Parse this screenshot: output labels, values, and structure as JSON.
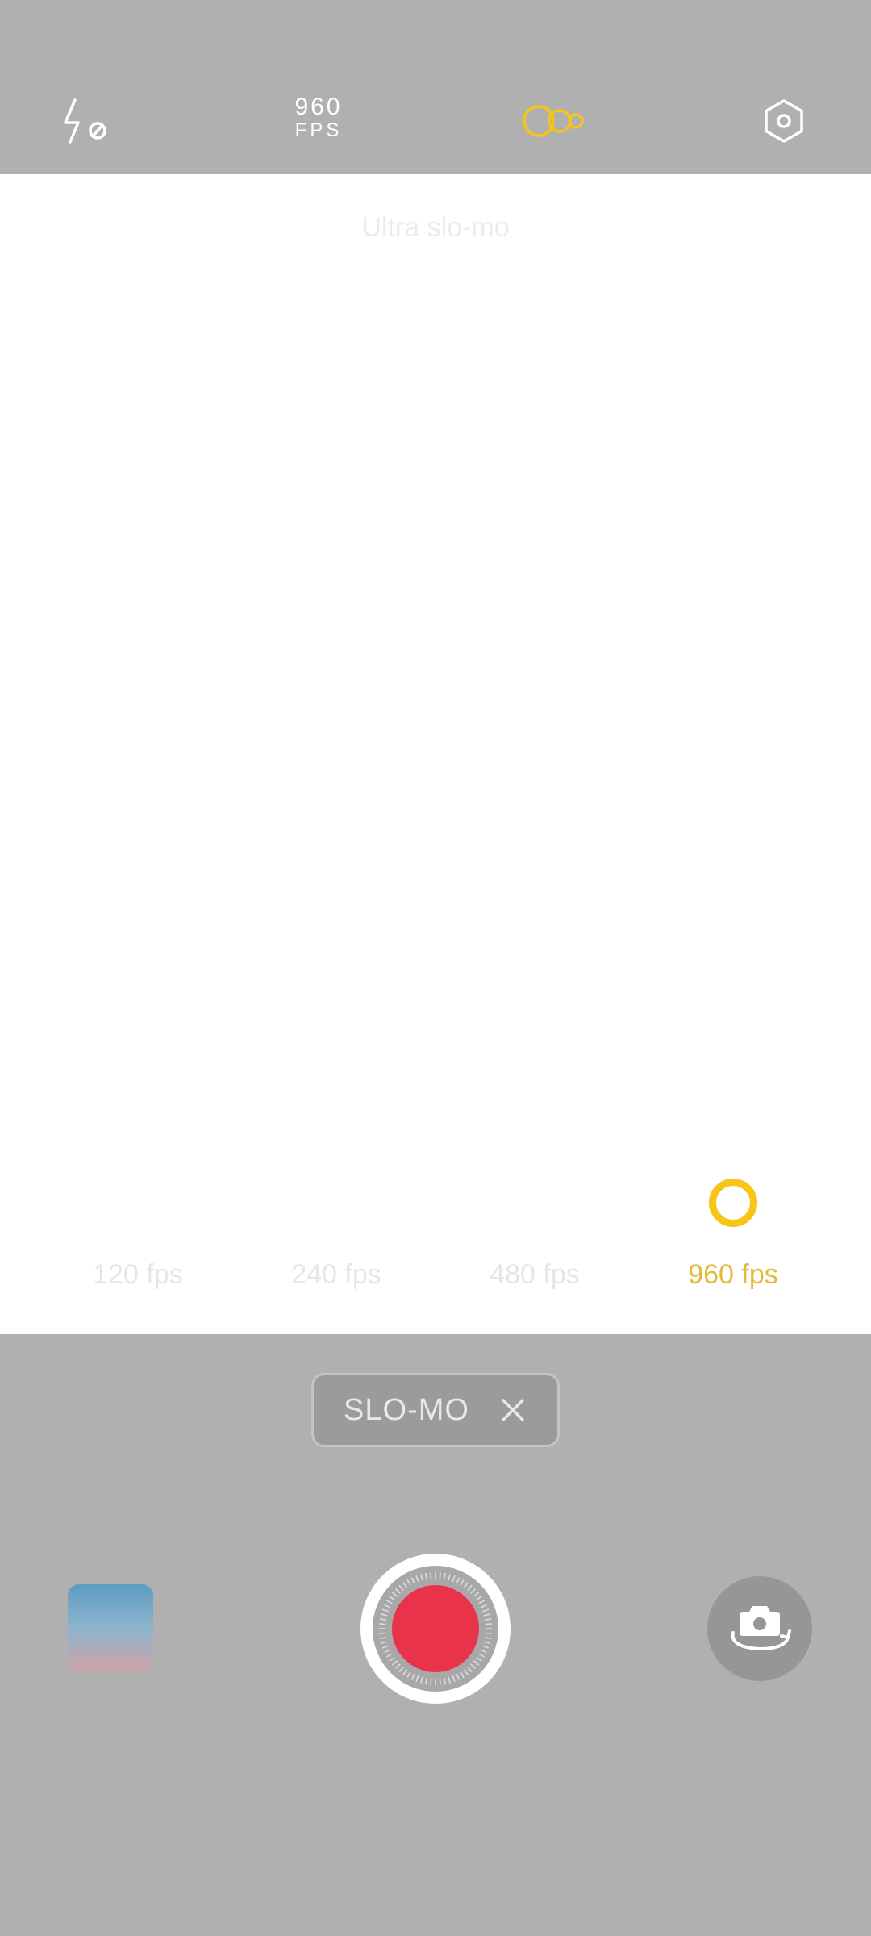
{
  "top_bar": {
    "flash_icon": "flash-off-icon",
    "fps_value": "960",
    "fps_unit": "FPS",
    "slowmo_icon": "slowmo-circles-icon",
    "settings_icon": "settings-hexagon-icon"
  },
  "viewfinder": {
    "mode_title": "Ultra slo-mo",
    "fps_options": [
      {
        "label": "120 fps",
        "selected": false
      },
      {
        "label": "240 fps",
        "selected": false
      },
      {
        "label": "480 fps",
        "selected": false
      },
      {
        "label": "960 fps",
        "selected": true
      }
    ]
  },
  "bottom": {
    "mode_chip_label": "SLO-MO",
    "close_icon": "close-icon",
    "gallery_icon": "gallery-thumbnail",
    "shutter_icon": "record-button",
    "flip_icon": "camera-flip-icon"
  },
  "colors": {
    "accent": "#f6c518",
    "record": "#e8334a",
    "bar_background": "#b0b0b0"
  }
}
